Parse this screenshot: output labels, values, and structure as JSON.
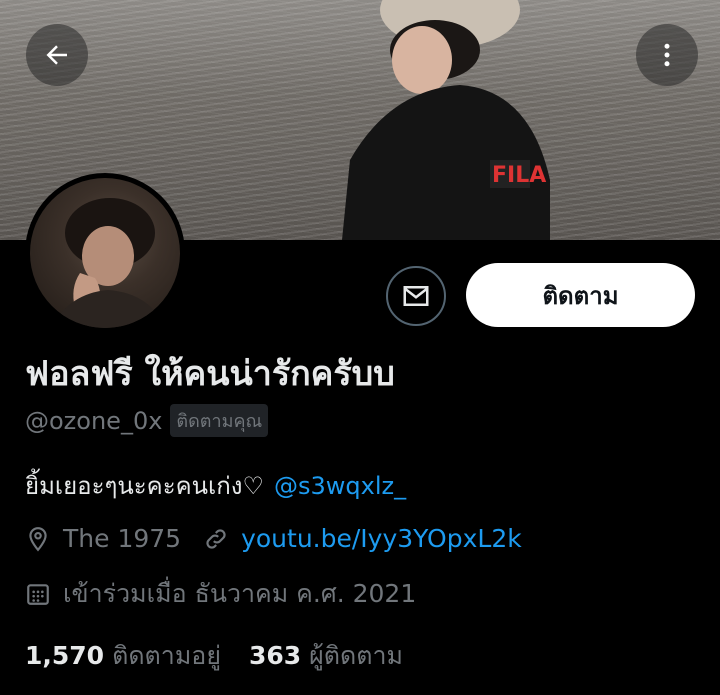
{
  "profile": {
    "display_name": "ฟอลฟรี ให้คนน่ารักครับบ",
    "handle": "@ozone_0x",
    "follows_you_badge": "ติดตามคุณ",
    "bio_text": "ยิ้มเยอะๆนะคะคนเก่ง♡",
    "bio_mention": "@s3wqxlz_",
    "location": "The 1975",
    "website": "youtu.be/Iyy3YOpxL2k",
    "joined": "เข้าร่วมเมื่อ ธันวาคม ค.ศ. 2021"
  },
  "actions": {
    "follow_label": "ติดตาม"
  },
  "stats": {
    "following_count": "1,570",
    "following_label": "ติดตามอยู่",
    "followers_count": "363",
    "followers_label": "ผู้ติดตาม"
  },
  "icons": {
    "back": "back-arrow-icon",
    "more": "more-vertical-icon",
    "message": "envelope-icon",
    "location": "location-pin-icon",
    "link": "link-icon",
    "calendar": "calendar-icon"
  },
  "colors": {
    "background": "#000000",
    "primary_text": "#e7e9ea",
    "secondary_text": "#71767b",
    "link": "#1d9bf0",
    "follow_button_bg": "#ffffff"
  }
}
